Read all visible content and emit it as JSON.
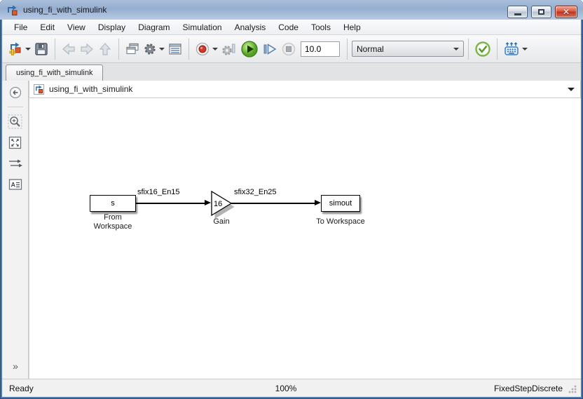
{
  "window": {
    "title": "using_fi_with_simulink"
  },
  "menu": {
    "items": [
      "File",
      "Edit",
      "View",
      "Display",
      "Diagram",
      "Simulation",
      "Analysis",
      "Code",
      "Tools",
      "Help"
    ]
  },
  "toolbar": {
    "stop_time": "10.0",
    "mode": "Normal"
  },
  "tab_bar": {
    "active_tab": "using_fi_with_simulink"
  },
  "breadcrumb": {
    "path": "using_fi_with_simulink"
  },
  "diagram": {
    "blocks": [
      {
        "label": "s",
        "caption": "From Workspace"
      },
      {
        "label": "16",
        "caption": "Gain"
      },
      {
        "label": "simout",
        "caption": "To Workspace"
      }
    ],
    "signals": [
      {
        "label": "sfix16_En15"
      },
      {
        "label": "sfix32_En25"
      }
    ]
  },
  "statusbar": {
    "state": "Ready",
    "zoom": "100%",
    "solver": "FixedStepDiscrete"
  },
  "colors": {
    "titlebar_blue": "#96aecf",
    "run_green": "#6fbf3f",
    "record_red": "#c43b35",
    "close_red": "#c94433",
    "accent_blue": "#2f6fb0"
  }
}
